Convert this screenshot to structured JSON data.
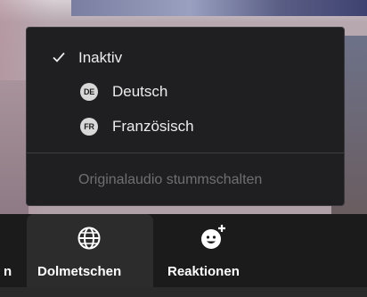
{
  "menu": {
    "items": [
      {
        "label": "Inaktiv",
        "checked": true
      },
      {
        "label": "Deutsch",
        "badge": "DE"
      },
      {
        "label": "Französisch",
        "badge": "FR"
      }
    ],
    "mute_label": "Originalaudio stummschalten"
  },
  "toolbar": {
    "partial_label": "n",
    "interpretation_label": "Dolmetschen",
    "reactions_label": "Reaktionen"
  },
  "icons": {
    "check": "checkmark-icon",
    "interpretation": "globe-icon",
    "reactions": "emoji-add-icon"
  },
  "colors": {
    "menu_bg": "#1f1f21",
    "toolbar_bg": "#1b1b1b",
    "disabled_text": "#6f6f72"
  }
}
